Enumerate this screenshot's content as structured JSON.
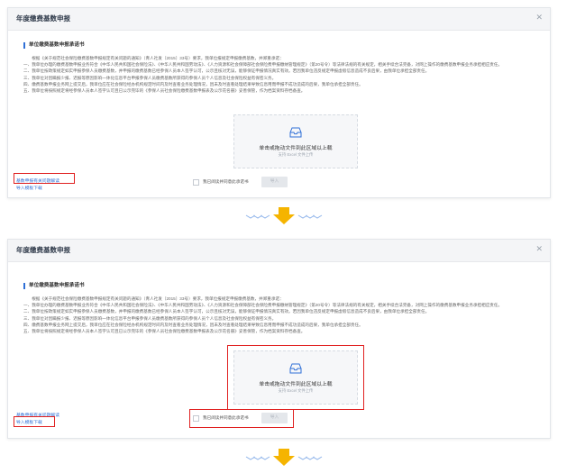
{
  "panel1": {
    "title": "年度缴费基数申报",
    "section_title": "单位缴费基数申报承诺书",
    "intro": "根据《关于规范社会保险缴费基数申报规定有关问题的通知》（青人社发〔2015〕33号）要求，我单位报规定申报缴费基数，并郑重承诺：",
    "items": [
      "一、我单位办理的缴费基数申报业务符合《中华人民共和国社会保险法》、《中华人民共和国劳动法》、《人力资源和社会保障部社会保险费申报缴纳管理规定》（第20号令）等法律法规的有关规定，相关手续合法完备，对网上操作的缴费基数申报业务承担相应责任。",
      "二、我单位按政策规定如实申报参保人员缴费基数，并申报的缴费基数已经参保人员本人签字认可，公示且核对无误，能够保证申报情况真实有效。若因我单位违反规定申报虚假信息造成不良后果，由我单位承担全部责任。",
      "三、我单位对因瞒报少报、迟报等原因影响一体化信息平台申报参保人员缴费基数所获得的参保人员个人信息及社会保险权益有保密义务。",
      "四、缴费基数申报业务网上提交后，我单位应在社会保险经办机构规定时间内及时查看业务处理情况，因未及时查看处理结果导致信息用而申报不成功造成的后果，我单位承担全部责任。",
      "五、我单位将按照规定将经参保人员本人签字认可且已公示完毕的《参保人员社会保险缴费基数申报表及公示花名册》妥善保管，作为档案资料存档备查。"
    ],
    "upload_main": "单击或拖动文件到此区域以上载",
    "upload_sub": "支持 Excel 文件上传",
    "agree_label": "我已阅读并同意此承诺书",
    "import_label": "导入",
    "faq_link": "基数申报有关问题解读",
    "template_link": "导入模板下载"
  },
  "panel2": {
    "title": "年度缴费基数申报",
    "section_title": "单位缴费基数申报承诺书",
    "intro": "根据《关于规范社会保险缴费基数申报规定有关问题的通知》（青人社发〔2015〕33号）要求，我单位报规定申报缴费基数，并郑重承诺：",
    "items": [
      "一、我单位办理的缴费基数申报业务符合《中华人民共和国社会保险法》、《中华人民共和国劳动法》、《人力资源和社会保障部社会保险费申报缴纳管理规定》（第20号令）等法律法规的有关规定，相关手续合法完备，对网上操作的缴费基数申报业务承担相应责任。",
      "二、我单位按政策规定如实申报参保人员缴费基数，并申报的缴费基数已经参保人员本人签字认可，公示且核对无误，能够保证申报情况真实有效。若因我单位违反规定申报虚假信息造成不良后果，由我单位承担全部责任。",
      "三、我单位对因瞒报少报、迟报等原因影响一体化信息平台申报参保人员缴费基数所获得的参保人员个人信息及社会保险权益有保密义务。",
      "四、缴费基数申报业务网上提交后，我单位应在社会保险经办机构规定时间内及时查看业务处理情况，因未及时查看处理结果导致信息用而申报不成功造成的后果，我单位承担全部责任。",
      "五、我单位将按照规定将经参保人员本人签字认可且已公示完毕的《参保人员社会保险缴费基数申报表及公示花名册》妥善保管，作为档案资料存档备查。"
    ],
    "upload_main": "单击或拖动文件到此区域以上载",
    "upload_sub": "支持 Excel 文件上传",
    "agree_label": "我已阅读并同意此承诺书",
    "import_label": "导入",
    "faq_link": "基数申报有关问题解读",
    "template_link": "导入模板下载"
  },
  "colors": {
    "accent": "#2f6fd6",
    "highlight": "#e02020",
    "arrow": "#f5b400",
    "chevron": "#8fb4ea"
  },
  "icons": {
    "close": "close-icon",
    "upload": "inbox-upload-icon",
    "step_arrow": "down-arrow-icon"
  }
}
